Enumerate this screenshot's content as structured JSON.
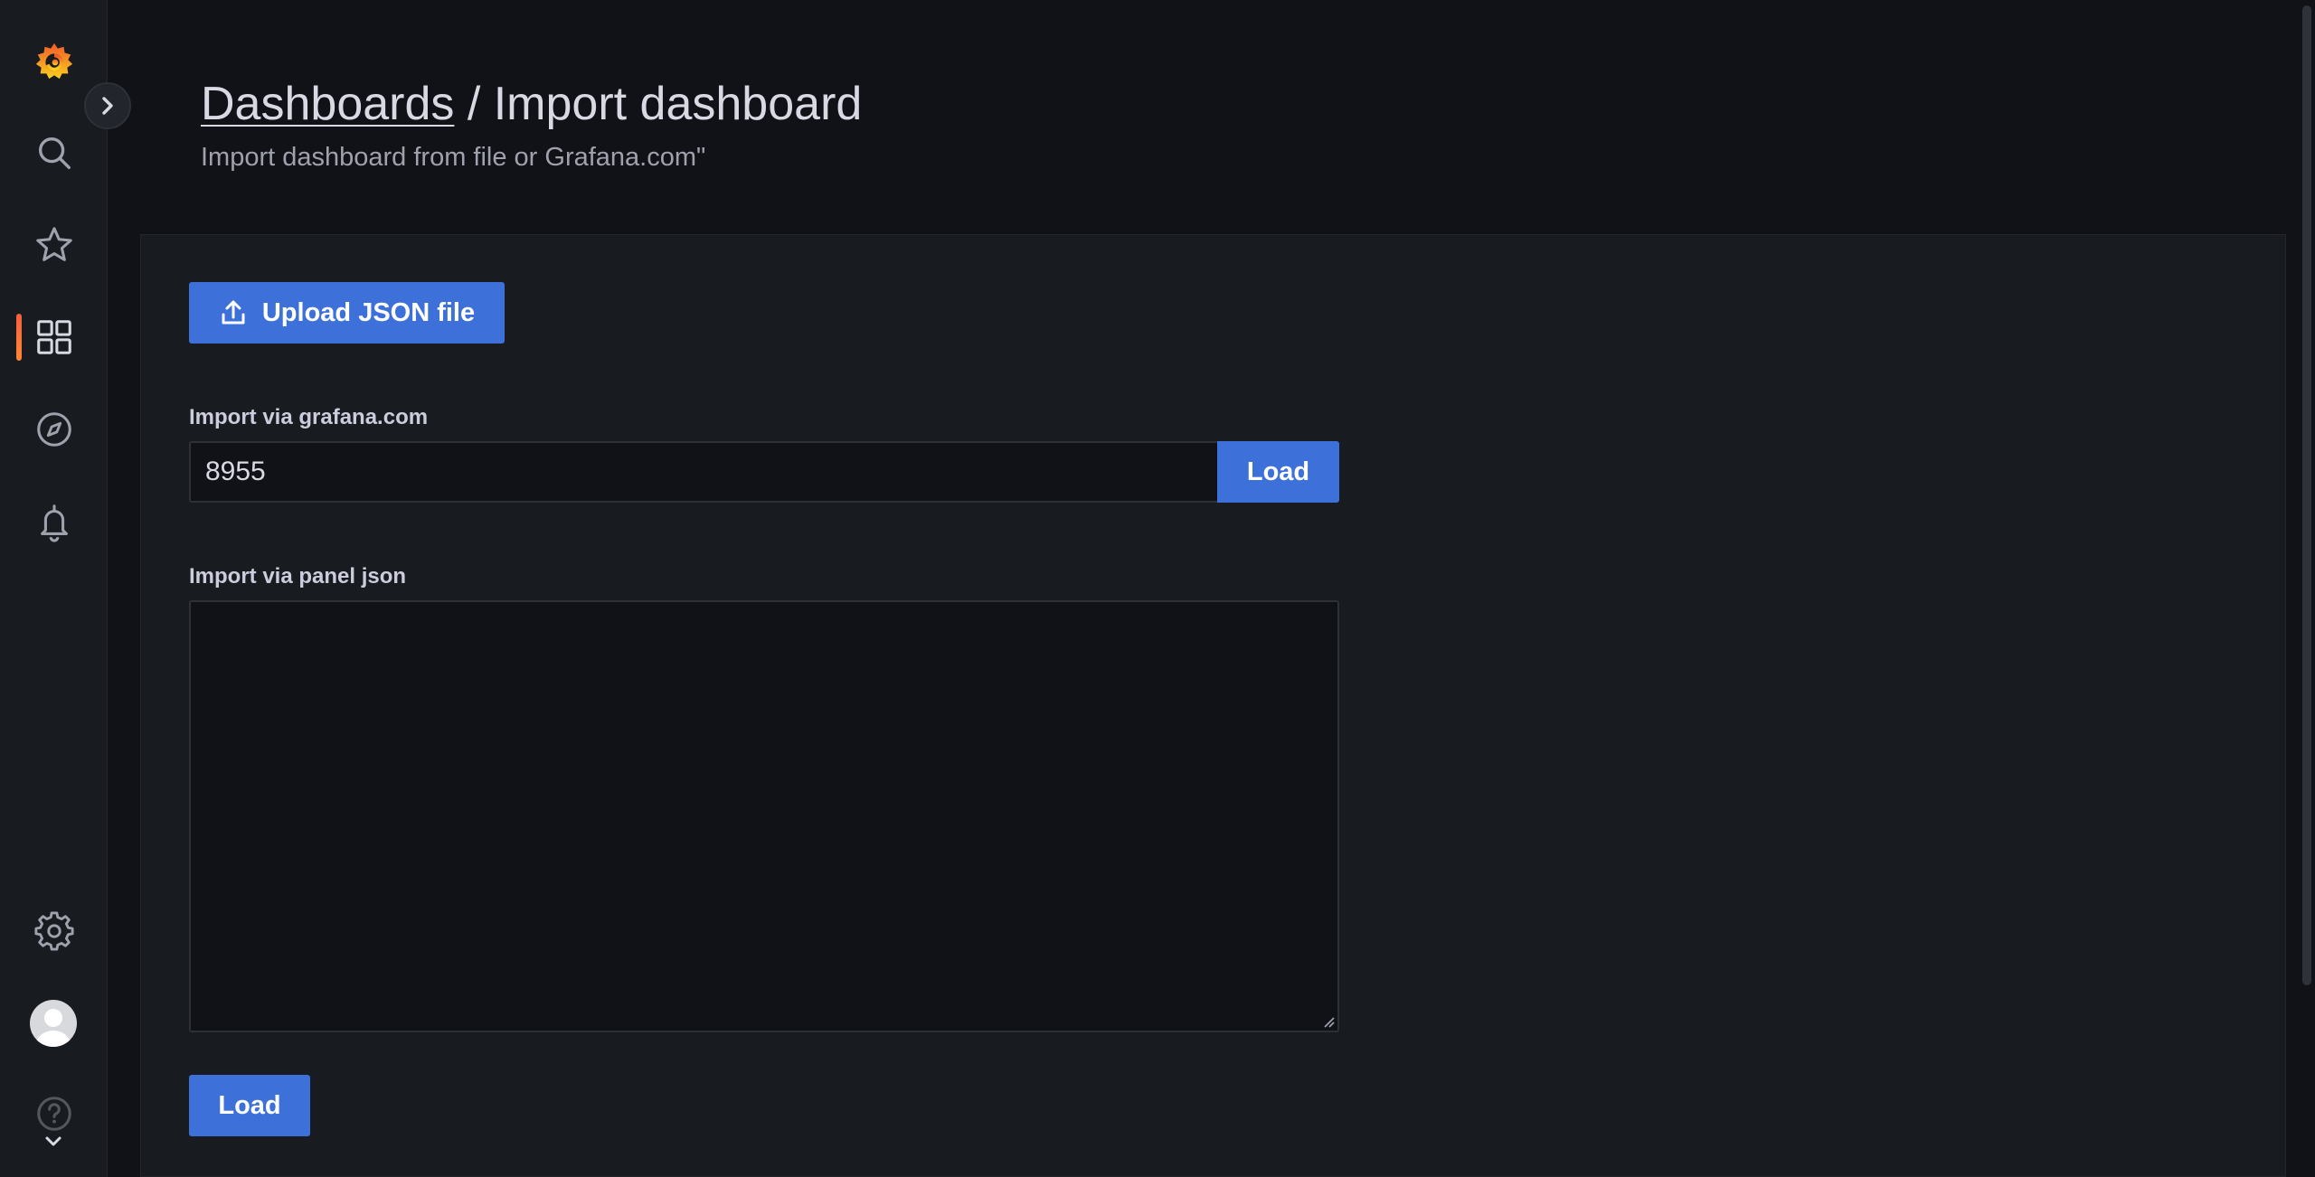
{
  "sidebar": {
    "logo": "grafana-logo",
    "items": [
      {
        "name": "search",
        "icon": "search-icon"
      },
      {
        "name": "starred",
        "icon": "star-icon"
      },
      {
        "name": "dashboards",
        "icon": "apps-grid-icon",
        "active": true
      },
      {
        "name": "explore",
        "icon": "compass-icon"
      },
      {
        "name": "alerting",
        "icon": "bell-icon"
      },
      {
        "name": "configuration",
        "icon": "gear-icon"
      },
      {
        "name": "profile",
        "icon": "avatar"
      },
      {
        "name": "help",
        "icon": "question-circle-icon"
      }
    ],
    "toggle_icon": "chevron-right-icon",
    "accent_color": "#f55f3e"
  },
  "header": {
    "breadcrumb_link": "Dashboards",
    "separator": " / ",
    "title": "Import dashboard",
    "subtitle": "Import dashboard from file or Grafana.com\""
  },
  "main": {
    "upload_button_label": "Upload JSON file",
    "upload_icon": "upload-icon",
    "grafana_label": "Import via grafana.com",
    "grafana_input_value": "8955",
    "grafana_load_label": "Load",
    "panel_json_label": "Import via panel json",
    "panel_json_value": "",
    "bottom_load_label": "Load"
  },
  "colors": {
    "primary_button": "#3d71d9",
    "background": "#111217",
    "panel": "#181b1f"
  }
}
